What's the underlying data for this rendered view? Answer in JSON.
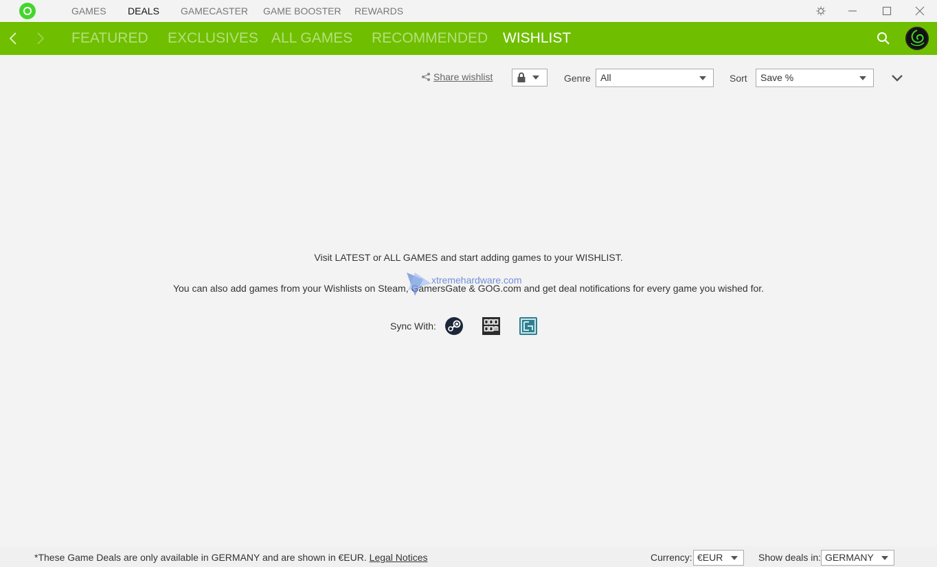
{
  "topnav": {
    "items": [
      {
        "label": "GAMES"
      },
      {
        "label": "DEALS"
      },
      {
        "label": "GAMECASTER"
      },
      {
        "label": "GAME BOOSTER"
      },
      {
        "label": "REWARDS"
      }
    ],
    "active": "DEALS"
  },
  "subnav": {
    "tabs": [
      {
        "label": "FEATURED"
      },
      {
        "label": "EXCLUSIVES"
      },
      {
        "label": "ALL GAMES"
      },
      {
        "label": "RECOMMENDED"
      },
      {
        "label": "WISHLIST"
      }
    ],
    "active": "WISHLIST"
  },
  "toolbar": {
    "share_label": "Share wishlist",
    "genre_label": "Genre",
    "genre_value": "All",
    "sort_label": "Sort",
    "sort_value": "Save %"
  },
  "empty_state": {
    "line1": "Visit LATEST or ALL GAMES and start adding games to your WISHLIST.",
    "line2": "You can also add games from your Wishlists on Steam, GamersGate & GOG.com and get deal notifications for every game you wished for.",
    "sync_label": "Sync With:",
    "sync_services": [
      "steam-icon",
      "gog-icon",
      "gamersgate-icon"
    ]
  },
  "watermark": {
    "text": "xtremehardware.com"
  },
  "footer": {
    "note": "*These Game Deals are only available in GERMANY and are shown in €EUR.",
    "legal_link": "Legal Notices",
    "currency_label": "Currency:",
    "currency_value": "€EUR",
    "region_label": "Show deals in:",
    "region_value": "GERMANY"
  },
  "colors": {
    "accent": "#6fbe00",
    "tab_inactive": "#b5e07a",
    "tab_active": "#ffffff",
    "background": "#f3f3f3"
  }
}
